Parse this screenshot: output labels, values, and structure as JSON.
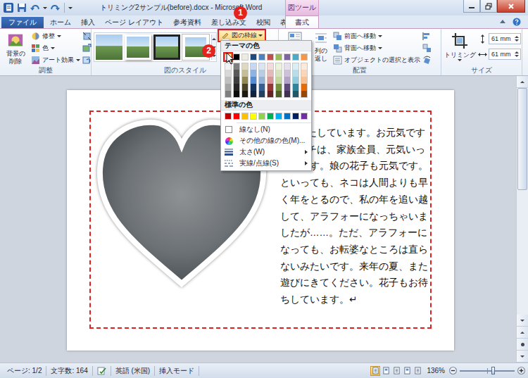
{
  "window": {
    "title": "トリミング2サンプル(before).docx - Microsoft Word",
    "context_label": "図ツール"
  },
  "tabs": [
    {
      "label": "ファイル",
      "kind": "file",
      "selected": false
    },
    {
      "label": "ホーム",
      "kind": "tab",
      "selected": false
    },
    {
      "label": "挿入",
      "kind": "tab",
      "selected": false
    },
    {
      "label": "ページ レイアウト",
      "kind": "tab",
      "selected": false
    },
    {
      "label": "参考資料",
      "kind": "tab",
      "selected": false
    },
    {
      "label": "差し込み文",
      "kind": "tab",
      "selected": false
    },
    {
      "label": "校閲",
      "kind": "tab",
      "selected": false
    },
    {
      "label": "表示",
      "kind": "tab",
      "selected": false
    },
    {
      "label": "書式",
      "kind": "context",
      "selected": true
    }
  ],
  "adjust_group": {
    "label": "調整",
    "remove_background": [
      "背景の",
      "削除"
    ],
    "buttons": [
      {
        "label": "修整"
      },
      {
        "label": "色"
      },
      {
        "label": "アート効果"
      }
    ]
  },
  "style_group": {
    "label": "図のスタイル",
    "border_button": {
      "label": "図の枠線",
      "highlighted": true,
      "open": true
    }
  },
  "arrange_group": {
    "label": "配置",
    "wrap_button": [
      "列の",
      "返し"
    ],
    "buttons": [
      {
        "label": "前面へ移動",
        "dropdown": true
      },
      {
        "label": "背面へ移動",
        "dropdown": true
      },
      {
        "label": "オブジェクトの選択と表示",
        "dropdown": false
      }
    ]
  },
  "size_group": {
    "label": "サイズ",
    "crop": "トリミング",
    "height": "61 mm",
    "width": "61 mm"
  },
  "menu": {
    "theme_header": "テーマの色",
    "theme_rows": [
      [
        {
          "color": "#FFFFFF",
          "selected": true
        },
        {
          "color": "#000000",
          "selected": false
        },
        {
          "color": "#EEECE1",
          "selected": false
        },
        {
          "color": "#1F497D",
          "selected": false
        },
        {
          "color": "#4F81BD",
          "selected": false
        },
        {
          "color": "#C0504D",
          "selected": false
        },
        {
          "color": "#9BBB59",
          "selected": false
        },
        {
          "color": "#8064A2",
          "selected": false
        },
        {
          "color": "#4BACC6",
          "selected": false
        },
        {
          "color": "#F79646",
          "selected": false
        }
      ],
      [
        {
          "color": "#F2F2F2",
          "selected": false
        },
        {
          "color": "#7F7F7F",
          "selected": false
        },
        {
          "color": "#DDD9C3",
          "selected": false
        },
        {
          "color": "#C6D9F0",
          "selected": false
        },
        {
          "color": "#DBE5F1",
          "selected": false
        },
        {
          "color": "#F2DCDB",
          "selected": false
        },
        {
          "color": "#EBF1DD",
          "selected": false
        },
        {
          "color": "#E5E0EC",
          "selected": false
        },
        {
          "color": "#DBEEF3",
          "selected": false
        },
        {
          "color": "#FDEADA",
          "selected": false
        }
      ],
      [
        {
          "color": "#D8D8D8",
          "selected": false
        },
        {
          "color": "#595959",
          "selected": false
        },
        {
          "color": "#C4BD97",
          "selected": false
        },
        {
          "color": "#8DB3E2",
          "selected": false
        },
        {
          "color": "#B8CCE4",
          "selected": false
        },
        {
          "color": "#E5B9B7",
          "selected": false
        },
        {
          "color": "#D7E3BC",
          "selected": false
        },
        {
          "color": "#CCC1D9",
          "selected": false
        },
        {
          "color": "#B7DDE8",
          "selected": false
        },
        {
          "color": "#FBD5B5",
          "selected": false
        }
      ],
      [
        {
          "color": "#BFBFBF",
          "selected": false
        },
        {
          "color": "#3F3F3F",
          "selected": false
        },
        {
          "color": "#938953",
          "selected": false
        },
        {
          "color": "#548DD4",
          "selected": false
        },
        {
          "color": "#95B3D7",
          "selected": false
        },
        {
          "color": "#D99694",
          "selected": false
        },
        {
          "color": "#C3D69B",
          "selected": false
        },
        {
          "color": "#B2A2C7",
          "selected": false
        },
        {
          "color": "#92CDDC",
          "selected": false
        },
        {
          "color": "#FAC08F",
          "selected": false
        }
      ],
      [
        {
          "color": "#A5A5A5",
          "selected": false
        },
        {
          "color": "#262626",
          "selected": false
        },
        {
          "color": "#494429",
          "selected": false
        },
        {
          "color": "#17365D",
          "selected": false
        },
        {
          "color": "#366092",
          "selected": false
        },
        {
          "color": "#953734",
          "selected": false
        },
        {
          "color": "#76923C",
          "selected": false
        },
        {
          "color": "#5F497A",
          "selected": false
        },
        {
          "color": "#31859B",
          "selected": false
        },
        {
          "color": "#E36C09",
          "selected": false
        }
      ],
      [
        {
          "color": "#7F7F7F",
          "selected": false
        },
        {
          "color": "#0C0C0C",
          "selected": false
        },
        {
          "color": "#1D1B10",
          "selected": false
        },
        {
          "color": "#0F243E",
          "selected": false
        },
        {
          "color": "#244061",
          "selected": false
        },
        {
          "color": "#632423",
          "selected": false
        },
        {
          "color": "#4F6128",
          "selected": false
        },
        {
          "color": "#3F3151",
          "selected": false
        },
        {
          "color": "#205867",
          "selected": false
        },
        {
          "color": "#974806",
          "selected": false
        }
      ]
    ],
    "standard_header": "標準の色",
    "standard_colors": [
      {
        "color": "#C00000",
        "selected": false
      },
      {
        "color": "#FF0000",
        "selected": false
      },
      {
        "color": "#FFC000",
        "selected": false
      },
      {
        "color": "#FFFF00",
        "selected": false
      },
      {
        "color": "#92D050",
        "selected": false
      },
      {
        "color": "#00B050",
        "selected": false
      },
      {
        "color": "#00B0F0",
        "selected": false
      },
      {
        "color": "#0070C0",
        "selected": false
      },
      {
        "color": "#002060",
        "selected": false
      },
      {
        "color": "#7030A0",
        "selected": false
      }
    ],
    "items": [
      {
        "label": "線なし(N)",
        "kind": "none",
        "submenu": false
      },
      {
        "label": "その他の線の色(M)...",
        "kind": "more",
        "submenu": false
      },
      {
        "label": "太さ(W)",
        "kind": "weight",
        "submenu": true
      },
      {
        "label": "実線/点線(S)",
        "kind": "dash",
        "submenu": true
      }
    ]
  },
  "callouts": [
    {
      "label": "1"
    },
    {
      "label": "2"
    }
  ],
  "document": {
    "lines": [
      {
        "text": "たしています。お元気です",
        "cut": true
      },
      {
        "text": "チは、家族全員、元気いっ",
        "cut": true
      },
      {
        "text": "ぱいです。娘の花子も元気です。",
        "cut": false
      },
      {
        "text": "といっても、ネコは人間よりも早",
        "cut": false
      },
      {
        "text": "く年をとるので、私の年を追い越",
        "cut": false
      },
      {
        "text": "して、アラフォーになっちゃいま",
        "cut": false
      },
      {
        "text": "したが……。ただ、アラフォーに",
        "cut": false
      },
      {
        "text": "なっても、お転婆なところは直ら",
        "cut": false
      },
      {
        "text": "ないみたいです。来年の夏、また",
        "cut": false
      },
      {
        "text": "遊びにきてください。花子もお待",
        "cut": false
      },
      {
        "text": "ちしています。↵",
        "cut": false
      }
    ]
  },
  "status_bar": {
    "page": "ページ: 1/2",
    "words": "文字数: 164",
    "language": "英語 (米国)",
    "mode": "挿入モード",
    "zoom": "136%",
    "zoom_level": 0.6,
    "views": [
      {
        "selected": true
      },
      {
        "selected": false
      },
      {
        "selected": false
      },
      {
        "selected": false
      },
      {
        "selected": false
      }
    ]
  },
  "scrollbar": {
    "level": 0,
    "thumb": 0.45
  }
}
